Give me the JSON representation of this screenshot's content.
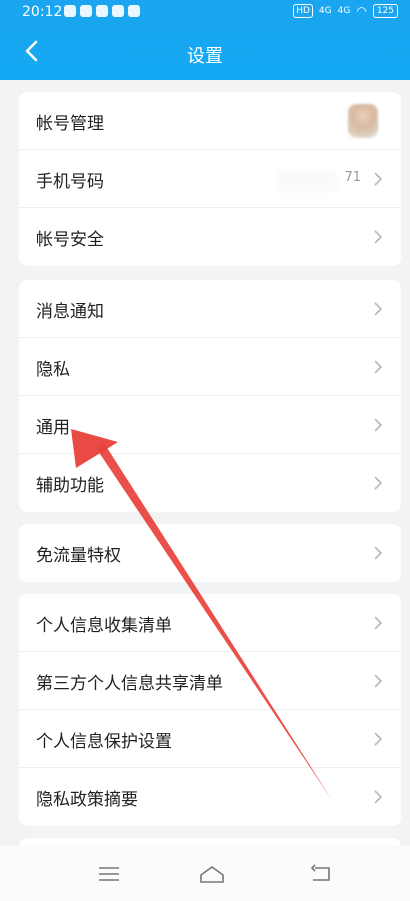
{
  "status_bar": {
    "time": "20:12",
    "hd_badge": "HD",
    "signal1": "4G",
    "signal2": "4G",
    "battery": "125"
  },
  "header": {
    "title": "设置"
  },
  "groups": [
    {
      "items": [
        {
          "label": "帐号管理",
          "avatar": true
        },
        {
          "label": "手机号码",
          "value": "71"
        },
        {
          "label": "帐号安全"
        }
      ]
    },
    {
      "items": [
        {
          "label": "消息通知"
        },
        {
          "label": "隐私"
        },
        {
          "label": "通用"
        },
        {
          "label": "辅助功能"
        }
      ]
    },
    {
      "items": [
        {
          "label": "免流量特权"
        }
      ]
    },
    {
      "items": [
        {
          "label": "个人信息收集清单"
        },
        {
          "label": "第三方个人信息共享清单"
        },
        {
          "label": "个人信息保护设置"
        },
        {
          "label": "隐私政策摘要"
        }
      ]
    }
  ],
  "annotation": {
    "color": "#e8413a",
    "points_to": "通用"
  },
  "colors": {
    "header_bg": "#14a9f3",
    "page_bg": "#f2f3f5"
  }
}
